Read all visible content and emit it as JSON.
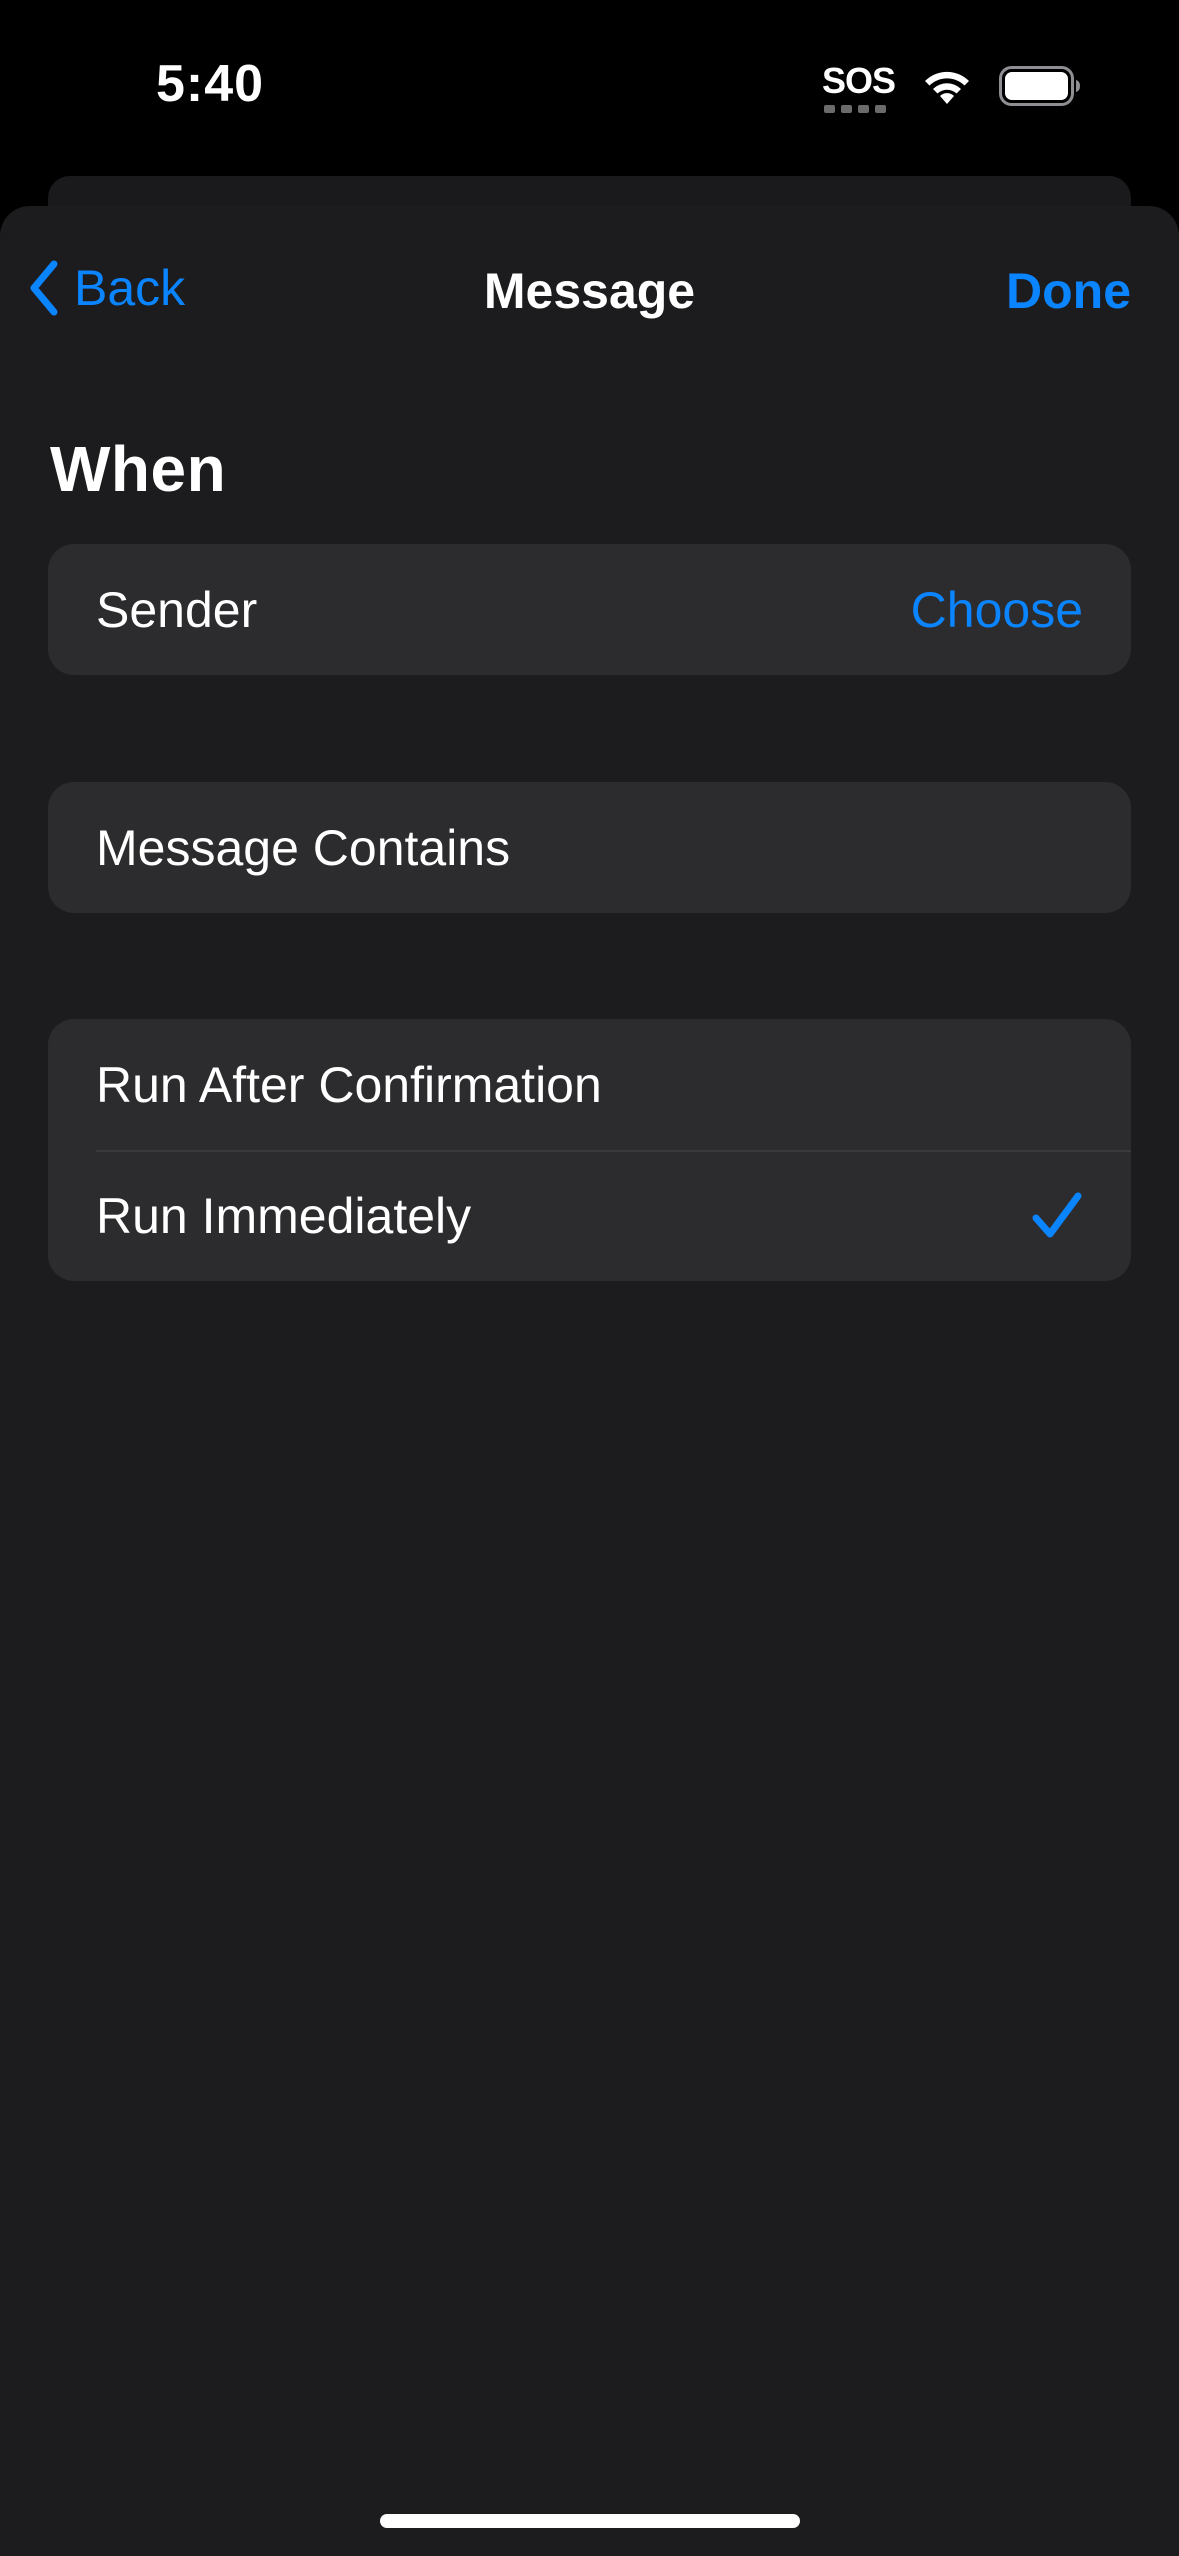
{
  "status_bar": {
    "time": "5:40",
    "sos": "SOS",
    "wifi_icon": "wifi-icon",
    "battery_icon": "battery-icon"
  },
  "nav": {
    "back_label": "Back",
    "title": "Message",
    "done_label": "Done",
    "back_icon": "chevron-left-icon"
  },
  "section": {
    "header": "When"
  },
  "sender_row": {
    "label": "Sender",
    "action": "Choose"
  },
  "contains_row": {
    "label": "Message Contains"
  },
  "run_options": [
    {
      "label": "Run After Confirmation",
      "selected": false
    },
    {
      "label": "Run Immediately",
      "selected": true
    }
  ],
  "colors": {
    "accent": "#0a84ff",
    "sheet_background": "#1c1c1e",
    "row_background": "#2c2c2e",
    "separator": "#3a3a3c"
  }
}
